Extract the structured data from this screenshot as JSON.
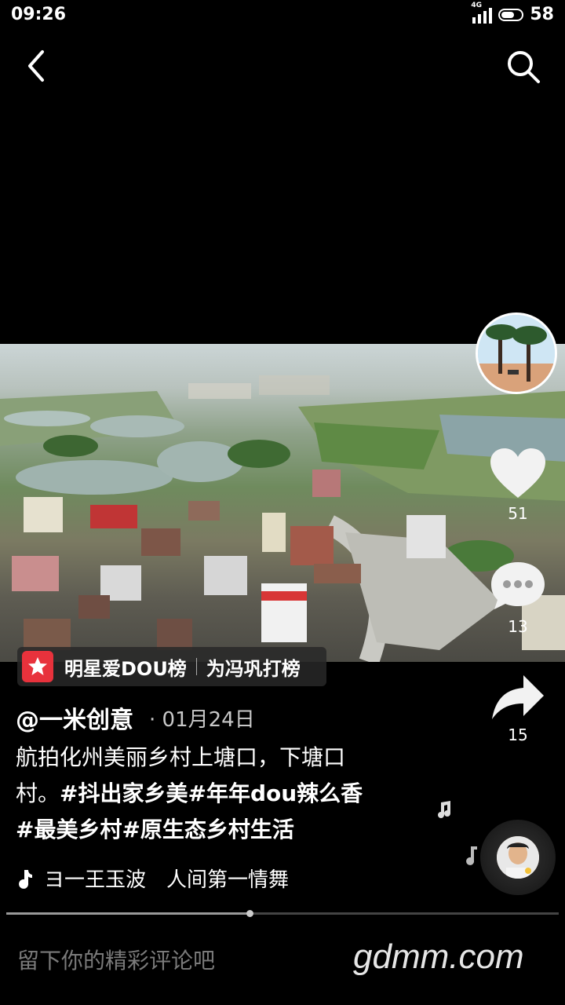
{
  "status": {
    "time": "09:26",
    "network": "4G",
    "battery": "58"
  },
  "side": {
    "likes": "51",
    "comments": "13",
    "shares": "15"
  },
  "badge": {
    "ranking": "明星爱DOU榜",
    "action": "为冯巩打榜"
  },
  "post": {
    "author": "@一米创意",
    "date": "· 01月24日",
    "text_line1": "航拍化州美丽乡村上塘口，下塘口",
    "text_line2_plain": "村。",
    "text_line2_tags": "#抖出家乡美#年年dou辣么香",
    "text_line3_tags": "#最美乡村#原生态乡村生活"
  },
  "music": {
    "title": "ヨ一王玉波　人间第一情舞"
  },
  "progress": 0.44,
  "comment": {
    "placeholder": "留下你的精彩评论吧"
  },
  "watermark": "gdmm.com",
  "icons": [
    "back-arrow-icon",
    "search-icon",
    "heart-icon",
    "comment-icon",
    "share-icon",
    "music-note-icon",
    "star-icon"
  ]
}
